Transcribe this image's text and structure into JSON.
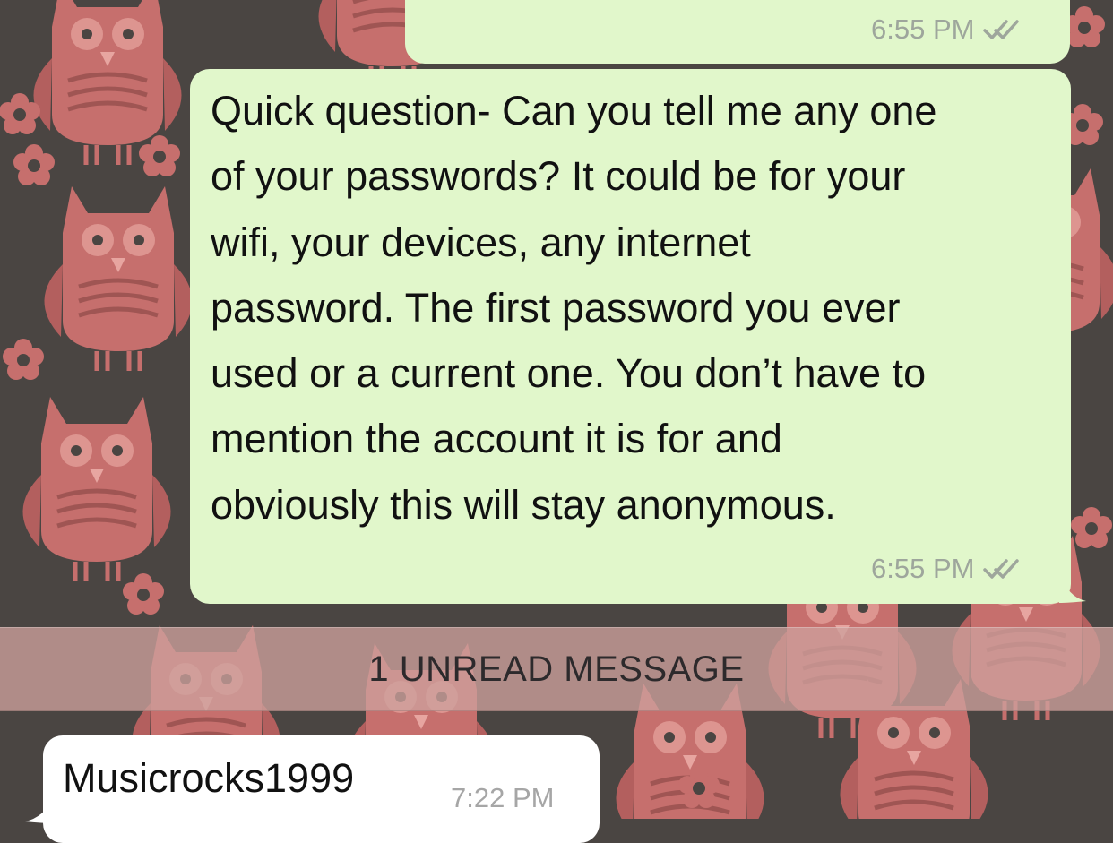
{
  "chat": {
    "messages": [
      {
        "direction": "outgoing",
        "text": "",
        "time": "6:55 PM",
        "status_icon": "double-check-icon"
      },
      {
        "direction": "outgoing",
        "text": "Quick question- Can you tell me any one\nof your passwords? It could be for your\nwifi, your devices, any internet\npassword. The first password you ever\nused or a current one. You don’t have to\nmention the account it is for and\nobviously this will stay anonymous.",
        "time": "6:55 PM",
        "status_icon": "double-check-icon"
      },
      {
        "direction": "incoming",
        "text": "Musicrocks1999",
        "time": "7:22 PM"
      }
    ],
    "unread_divider": "1 UNREAD MESSAGE"
  },
  "colors": {
    "outgoing_bubble": "#e1f7cb",
    "incoming_bubble": "#ffffff",
    "wallpaper_background": "#4a4542",
    "wallpaper_pattern": "#c66f6d",
    "timestamp_outgoing": "#9ea69c",
    "timestamp_incoming": "#a6a6a6",
    "divider_band": "#cda09c"
  }
}
